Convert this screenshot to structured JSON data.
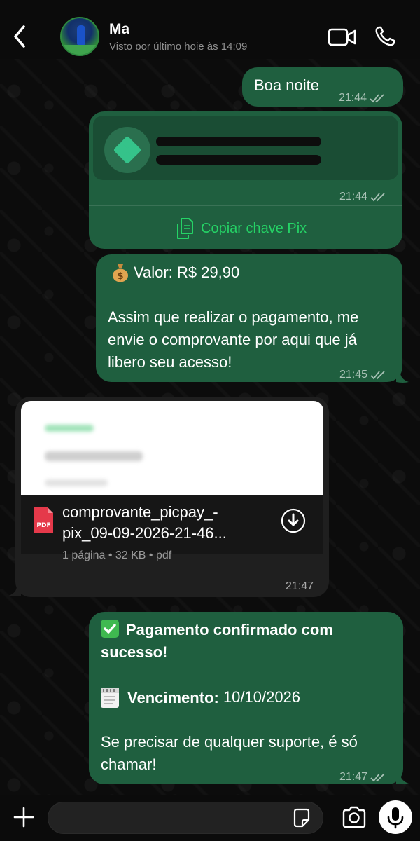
{
  "header": {
    "contact_name": "Ma",
    "status": "Visto por último hoje às 14:09"
  },
  "messages": [
    {
      "direction": "out",
      "text": "Boa noite",
      "time": "21:44"
    },
    {
      "direction": "out",
      "type": "pix",
      "time": "21:44",
      "action_label": "Copiar chave Pix"
    },
    {
      "direction": "out",
      "value_line": "Valor: R$ 29,90",
      "body": "Assim que realizar o pagamento, me envie o comprovante por aqui que já libero seu acesso!",
      "time": "21:45"
    },
    {
      "direction": "in",
      "type": "document",
      "file_name": "comprovante_picpay_-pix_09-09-2026-21-46...",
      "meta": "1 página • 32 KB • pdf",
      "file_badge": "PDF",
      "time": "21:47"
    },
    {
      "direction": "out",
      "title": "Pagamento confirmado com sucesso!",
      "due_label": "Vencimento",
      "due_date": "10/10/2026",
      "body": "Se precisar de qualquer suporte, é só chamar!",
      "time": "21:47"
    }
  ],
  "colors": {
    "outgoing_bubble": "#1f5f3f",
    "incoming_bubble": "#1f1f1f",
    "accent_green": "#25d366",
    "background": "#0b0b0b"
  },
  "icons": [
    "back-arrow-icon",
    "video-call-icon",
    "phone-icon",
    "pix-logo-icon",
    "copy-icon",
    "pdf-icon",
    "download-icon",
    "plus-icon",
    "sticker-icon",
    "camera-icon",
    "mic-icon",
    "read-ticks-icon"
  ]
}
